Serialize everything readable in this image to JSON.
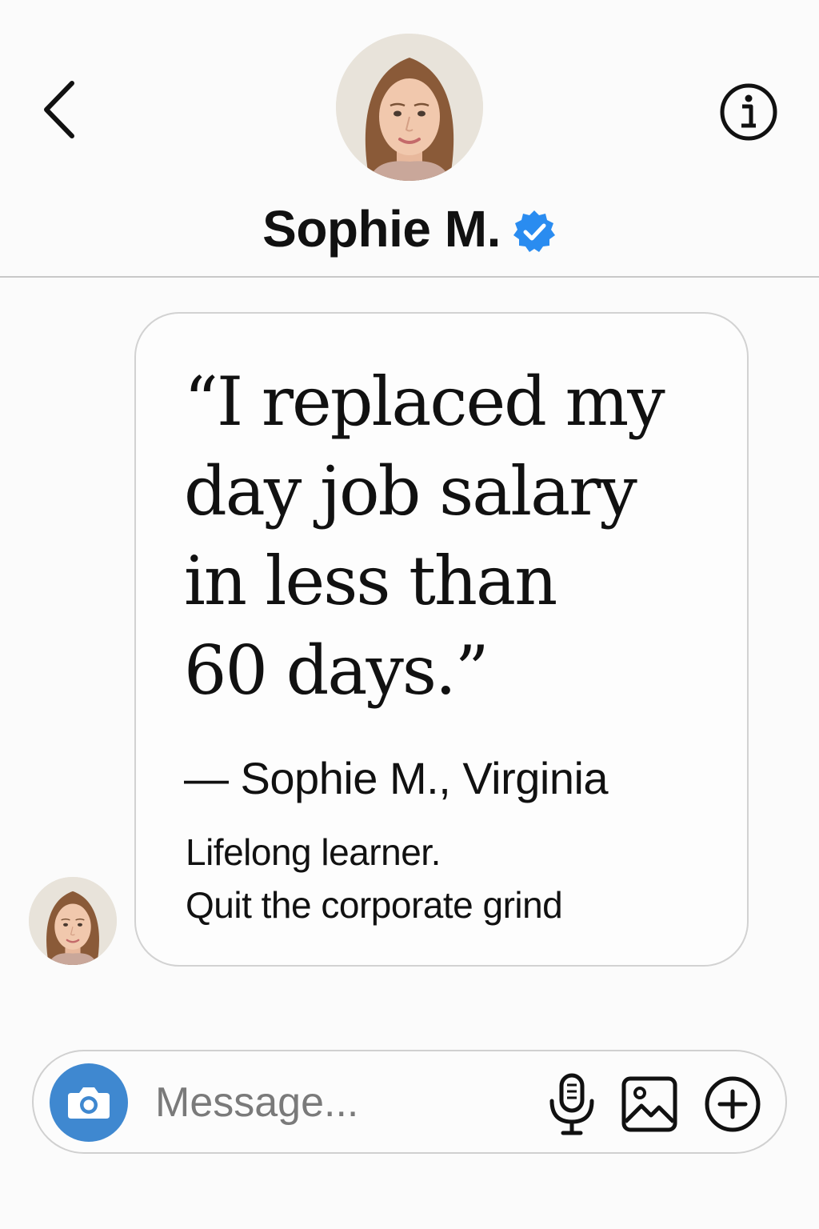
{
  "header": {
    "contact_name": "Sophie M.",
    "verified": true,
    "icons": {
      "back": "chevron-left-icon",
      "info": "info-icon",
      "verified": "verified-badge-icon"
    }
  },
  "message": {
    "quote_lines": [
      "“I replaced my",
      "day job salary",
      "in less than",
      "60 days.”"
    ],
    "attribution": "— Sophie M., Virginia",
    "bio_lines": [
      "Lifelong learner.",
      "Quit the corporate grind"
    ]
  },
  "composer": {
    "placeholder": "Message...",
    "icons": {
      "camera": "camera-icon",
      "mic": "microphone-icon",
      "gallery": "image-icon",
      "add": "plus-circle-icon"
    }
  },
  "colors": {
    "accent": "#3f88d0",
    "verified_badge": "#2a8cf0",
    "text": "#111111",
    "placeholder": "#7a7a7a",
    "border": "#d2d2d2"
  }
}
